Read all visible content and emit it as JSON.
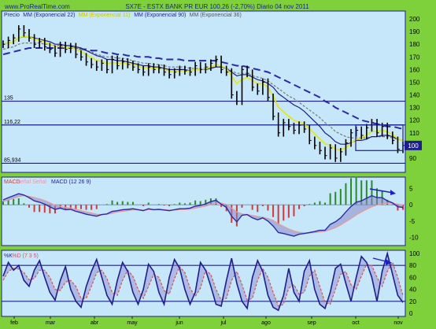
{
  "header": {
    "site": "www.ProRealTime.com",
    "title": "SX7E - ESTX BANK PR EUR    100,26 (-2,70%)    Diario  04 nov 2011"
  },
  "colors": {
    "frame": "#7fd13b",
    "panel_bg": "#c6e6fa",
    "price": "#000000",
    "ema22": "#1e1e8c",
    "ema11": "#e8e800",
    "ema90": "#2a2aa8",
    "ema36": "#777777",
    "macd": "#2a2aa8",
    "signal": "#e89a9a",
    "hist_pos": "#2a8a2a",
    "hist_neg": "#d23a3a",
    "stoch_k": "#1e1e8c",
    "stoch_d": "#e05050",
    "hline": "#1e1e8c",
    "annotation": "#1e1ecc"
  },
  "chart_data": [
    {
      "type": "line",
      "panel": "price",
      "legend": [
        {
          "name": "Precio",
          "key": "price"
        },
        {
          "name": "MM (Exponencial 22)",
          "key": "ema22"
        },
        {
          "name": "MM (Exponencial 11)",
          "key": "ema11"
        },
        {
          "name": "MM (Exponencial 90)",
          "key": "ema90"
        },
        {
          "name": "MM (Exponencial 36)",
          "key": "ema36"
        }
      ],
      "x": [
        "feb",
        "mar",
        "abr",
        "may",
        "jun",
        "jul",
        "ago",
        "sep",
        "oct",
        "nov"
      ],
      "price": [
        180,
        183,
        185,
        192,
        189,
        185,
        180,
        182,
        178,
        176,
        173,
        179,
        176,
        178,
        172,
        170,
        166,
        164,
        162,
        165,
        160,
        168,
        163,
        166,
        164,
        162,
        160,
        158,
        162,
        160,
        161,
        158,
        156,
        158,
        160,
        159,
        158,
        163,
        160,
        162,
        165,
        168,
        160,
        158,
        140,
        135,
        160,
        157,
        146,
        143,
        150,
        138,
        123,
        110,
        118,
        115,
        112,
        116,
        113,
        104,
        100,
        96,
        92,
        98,
        90,
        95,
        102,
        110,
        112,
        108,
        114,
        118,
        110,
        115,
        108,
        104,
        97,
        100
      ],
      "ema22": [
        180,
        181,
        182,
        185,
        186,
        186,
        185,
        184,
        183,
        182,
        180,
        180,
        179,
        179,
        178,
        177,
        175,
        173,
        171,
        170,
        168,
        168,
        167,
        167,
        166,
        165,
        164,
        163,
        163,
        162,
        162,
        161,
        160,
        160,
        160,
        160,
        159,
        160,
        160,
        160,
        161,
        162,
        162,
        161,
        158,
        155,
        156,
        156,
        154,
        152,
        151,
        149,
        146,
        141,
        138,
        135,
        132,
        130,
        127,
        123,
        119,
        115,
        110,
        107,
        103,
        101,
        101,
        102,
        104,
        104,
        105,
        107,
        107,
        108,
        108,
        107,
        105,
        104
      ],
      "ema90": [
        172,
        173,
        174,
        175,
        176,
        177,
        177,
        177,
        177,
        177,
        177,
        177,
        177,
        177,
        177,
        176,
        176,
        175,
        175,
        174,
        173,
        173,
        172,
        172,
        171,
        171,
        170,
        170,
        170,
        169,
        169,
        168,
        168,
        168,
        168,
        167,
        167,
        167,
        167,
        167,
        167,
        167,
        166,
        165,
        164,
        163,
        163,
        162,
        161,
        160,
        159,
        158,
        156,
        154,
        152,
        150,
        148,
        146,
        144,
        142,
        140,
        138,
        135,
        133,
        130,
        128,
        126,
        124,
        122,
        120,
        119,
        118,
        117,
        116,
        115,
        115,
        114,
        113
      ],
      "ema36": [
        176,
        177,
        178,
        180,
        181,
        181,
        181,
        181,
        180,
        180,
        179,
        179,
        178,
        178,
        177,
        176,
        175,
        174,
        172,
        171,
        170,
        170,
        169,
        169,
        168,
        167,
        166,
        165,
        165,
        164,
        164,
        163,
        162,
        162,
        162,
        162,
        161,
        161,
        161,
        161,
        162,
        162,
        162,
        161,
        159,
        157,
        157,
        157,
        155,
        154,
        153,
        151,
        148,
        145,
        142,
        139,
        137,
        134,
        131,
        128,
        125,
        122,
        118,
        115,
        111,
        109,
        107,
        106,
        106,
        106,
        106,
        107,
        107,
        107,
        107,
        106,
        105,
        104
      ],
      "ylim": [
        80,
        205
      ],
      "yticks": [
        "200",
        "190",
        "180",
        "170",
        "160",
        "150",
        "140",
        "130",
        "120",
        "110",
        "100",
        "90"
      ],
      "levels": [
        {
          "value": 135,
          "label": "135"
        },
        {
          "value": 116.22,
          "label": "116,22"
        },
        {
          "value": 85.934,
          "label": "85,934"
        }
      ],
      "last_value_label": "100"
    },
    {
      "type": "line",
      "panel": "macd",
      "legend": [
        {
          "name": "MACD",
          "key": "macd"
        },
        {
          "name": "señal Señal",
          "key": "signal"
        },
        {
          "name": "MACD (12 26 9)",
          "key": "hist"
        }
      ],
      "macd": [
        1.5,
        2.2,
        2.8,
        3.4,
        3.0,
        2.2,
        1.2,
        0.8,
        0.2,
        -0.6,
        -1.4,
        -1.0,
        -1.5,
        -1.4,
        -2.0,
        -2.4,
        -2.9,
        -3.2,
        -3.5,
        -3.0,
        -2.8,
        -2.0,
        -1.8,
        -1.5,
        -1.4,
        -1.2,
        -1.5,
        -1.8,
        -1.2,
        -1.5,
        -1.4,
        -1.6,
        -1.8,
        -1.5,
        -1.2,
        -1.2,
        -1.0,
        -0.4,
        -0.2,
        0.3,
        1.0,
        1.4,
        0.2,
        -0.8,
        -3.5,
        -5.2,
        -3.2,
        -3.0,
        -4.0,
        -4.6,
        -4.0,
        -5.0,
        -6.5,
        -8.5,
        -8.8,
        -9.2,
        -9.6,
        -9.0,
        -8.8,
        -8.5,
        -8.2,
        -7.8,
        -7.8,
        -6.0,
        -5.2,
        -4.0,
        -2.2,
        -0.5,
        0.8,
        1.2,
        2.0,
        2.8,
        2.2,
        2.2,
        1.2,
        0.6,
        -0.6,
        -0.8
      ],
      "signal": [
        1.0,
        1.5,
        2.0,
        2.5,
        2.8,
        2.6,
        2.2,
        1.8,
        1.3,
        0.6,
        -0.2,
        -0.5,
        -0.8,
        -1.0,
        -1.4,
        -1.8,
        -2.2,
        -2.5,
        -2.9,
        -3.0,
        -2.9,
        -2.6,
        -2.2,
        -2.0,
        -1.8,
        -1.6,
        -1.5,
        -1.6,
        -1.5,
        -1.5,
        -1.5,
        -1.5,
        -1.6,
        -1.6,
        -1.5,
        -1.4,
        -1.3,
        -1.0,
        -0.7,
        -0.4,
        0.1,
        0.5,
        0.5,
        0.1,
        -1.0,
        -2.2,
        -2.8,
        -3.0,
        -3.3,
        -3.6,
        -3.8,
        -4.2,
        -4.8,
        -5.8,
        -6.6,
        -7.4,
        -8.0,
        -8.4,
        -8.6,
        -8.6,
        -8.5,
        -8.3,
        -8.1,
        -7.6,
        -7.0,
        -6.2,
        -5.2,
        -4.2,
        -3.1,
        -2.2,
        -1.4,
        -0.6,
        -0.1,
        0.3,
        0.5,
        0.5,
        0.2,
        -0.1
      ],
      "ylim": [
        -12,
        8
      ],
      "yticks": [
        "5",
        "0",
        "-5",
        "-10"
      ]
    },
    {
      "type": "line",
      "panel": "stochastic",
      "legend": [
        {
          "name": "%K",
          "key": "k"
        },
        {
          "name": "%D (7 3 5)",
          "key": "d"
        }
      ],
      "k": [
        62,
        85,
        72,
        80,
        55,
        45,
        72,
        88,
        60,
        35,
        22,
        55,
        78,
        40,
        20,
        10,
        45,
        70,
        90,
        60,
        30,
        15,
        55,
        85,
        70,
        35,
        15,
        40,
        82,
        70,
        35,
        15,
        60,
        90,
        75,
        40,
        15,
        35,
        85,
        72,
        45,
        15,
        12,
        55,
        92,
        50,
        20,
        8,
        60,
        88,
        70,
        30,
        10,
        5,
        30,
        75,
        35,
        20,
        70,
        88,
        40,
        15,
        8,
        35,
        75,
        82,
        50,
        20,
        60,
        95,
        85,
        60,
        20,
        70,
        100,
        65,
        30,
        18
      ],
      "d": [
        55,
        70,
        75,
        74,
        68,
        56,
        58,
        72,
        72,
        60,
        40,
        38,
        52,
        55,
        45,
        25,
        25,
        45,
        68,
        72,
        58,
        35,
        30,
        55,
        72,
        62,
        40,
        25,
        45,
        65,
        60,
        38,
        32,
        58,
        78,
        68,
        42,
        28,
        42,
        72,
        65,
        40,
        22,
        25,
        55,
        70,
        48,
        22,
        25,
        55,
        75,
        60,
        35,
        12,
        15,
        42,
        48,
        32,
        35,
        62,
        72,
        45,
        18,
        15,
        40,
        65,
        70,
        48,
        40,
        62,
        82,
        80,
        60,
        45,
        70,
        85,
        60,
        30
      ],
      "ylim": [
        0,
        100
      ],
      "yticks": [
        "100",
        "80",
        "60",
        "40",
        "20",
        "0"
      ],
      "levels": [
        {
          "value": 80
        },
        {
          "value": 20
        }
      ]
    }
  ]
}
